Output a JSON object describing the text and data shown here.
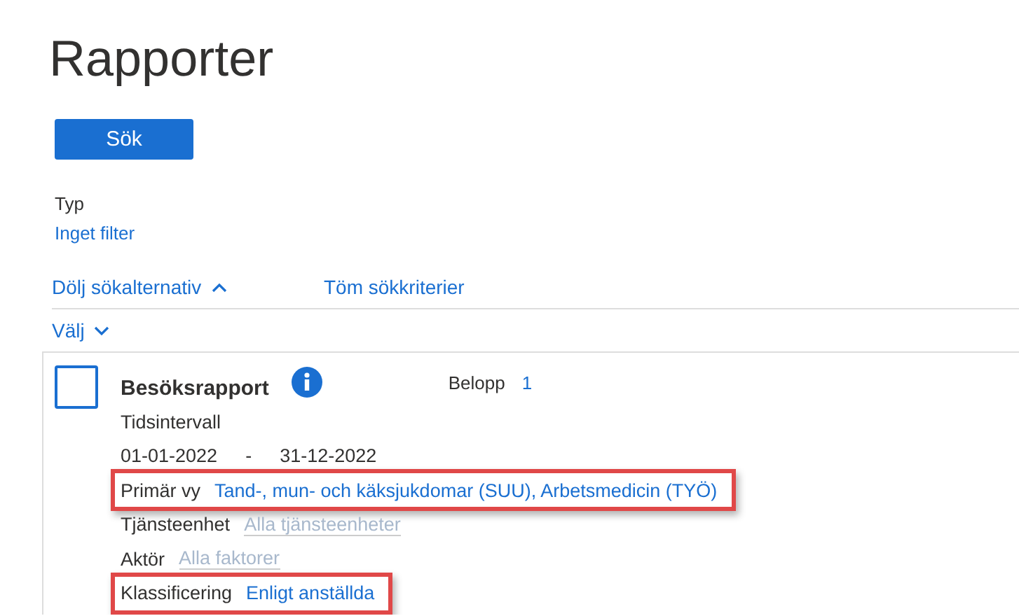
{
  "page": {
    "title": "Rapporter"
  },
  "search_button": {
    "label": "Sök"
  },
  "type_filter": {
    "label": "Typ",
    "value": "Inget filter"
  },
  "options_links": [
    {
      "label": "Dölj sökalternativ",
      "kind": "toggle",
      "expanded": true
    },
    {
      "label": "Töm sökkriterier",
      "kind": "plain"
    }
  ],
  "select_menu": {
    "label": "Välj",
    "expanded": false
  },
  "report": {
    "name": "Besöksrapport",
    "checked": false,
    "amount_label": "Belopp",
    "amount_value": "1",
    "rows": [
      {
        "kind": "heading",
        "label": "Tidsintervall"
      },
      {
        "kind": "range",
        "from": "01-01-2022",
        "separator": "-",
        "to": "31-12-2022"
      },
      {
        "kind": "filter",
        "label": "Primär vy",
        "value": "Tand-, mun- och käksjukdomar (SUU), Arbetsmedicin (TYÖ)",
        "muted": false,
        "highlighted": true
      },
      {
        "kind": "filter",
        "label": "Tjänsteenhet",
        "value": "Alla tjänsteenheter",
        "muted": true,
        "highlighted": false
      },
      {
        "kind": "filter",
        "label": "Aktör",
        "value": "Alla faktorer",
        "muted": true,
        "highlighted": false
      },
      {
        "kind": "filter",
        "label": "Klassificering",
        "value": "Enligt anställda",
        "muted": false,
        "highlighted": true
      }
    ]
  }
}
